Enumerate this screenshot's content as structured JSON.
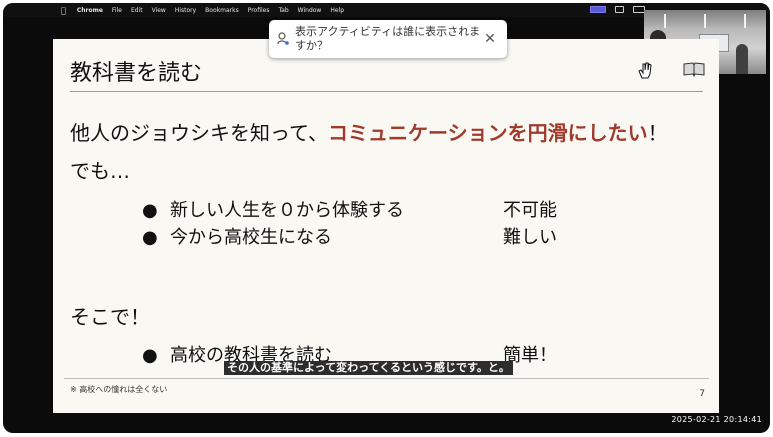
{
  "menubar": {
    "app": "Chrome",
    "items": [
      "File",
      "Edit",
      "View",
      "History",
      "Bookmarks",
      "Profiles",
      "Tab",
      "Window",
      "Help"
    ]
  },
  "notification": {
    "text": "表示アクティビティは誰に表示されますか？",
    "icon": "person-icon"
  },
  "slide": {
    "title": "教科書を読む",
    "line1_prefix": "他人のジョウシキを知って、",
    "line1_emphasis": "コミュニケーションを円滑にしたい",
    "line1_suffix": "！",
    "line2": "でも…",
    "bullets1": [
      {
        "text": "新しい人生を０から体験する",
        "result": "不可能"
      },
      {
        "text": "今から高校生になる",
        "result": "難しい"
      }
    ],
    "line3": "そこで！",
    "bullets2": [
      {
        "text": "高校の教科書を読む",
        "result": "簡単！"
      }
    ],
    "caption": "その人の基準によって変わってくるという感じです。と。",
    "footnote": "※ 高校への憧れは全くない",
    "page_number": "7",
    "accent_color": "#a03a2c"
  },
  "timestamp": "2025-02-21 20:14:41"
}
